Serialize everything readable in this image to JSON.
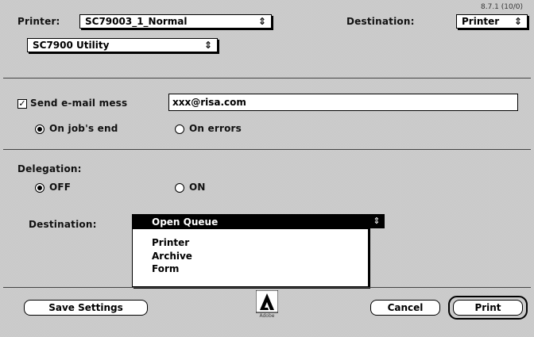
{
  "version": "8.7.1 (10/0)",
  "printer": {
    "label": "Printer:",
    "value": "SC79003_1_Normal"
  },
  "top_destination": {
    "label": "Destination:",
    "value": "Printer"
  },
  "utility_popup": {
    "value": "SC7900 Utility"
  },
  "email": {
    "checkbox_label": "Send e-mail mess",
    "checked": true,
    "value": "xxx@risa.com"
  },
  "notify": {
    "jobs_end": "On job's end",
    "errors": "On errors",
    "selected": "jobs_end"
  },
  "delegation": {
    "label": "Delegation:",
    "off": "OFF",
    "on": "ON",
    "selected": "off"
  },
  "destination_menu": {
    "label": "Destination:",
    "selected_item": "Open Queue",
    "items": [
      "Printer",
      "Archive",
      "Form"
    ]
  },
  "buttons": {
    "save": "Save Settings",
    "cancel": "Cancel",
    "print": "Print"
  },
  "logo": {
    "name": "adobe-logo-icon",
    "caption": "Adobe"
  }
}
